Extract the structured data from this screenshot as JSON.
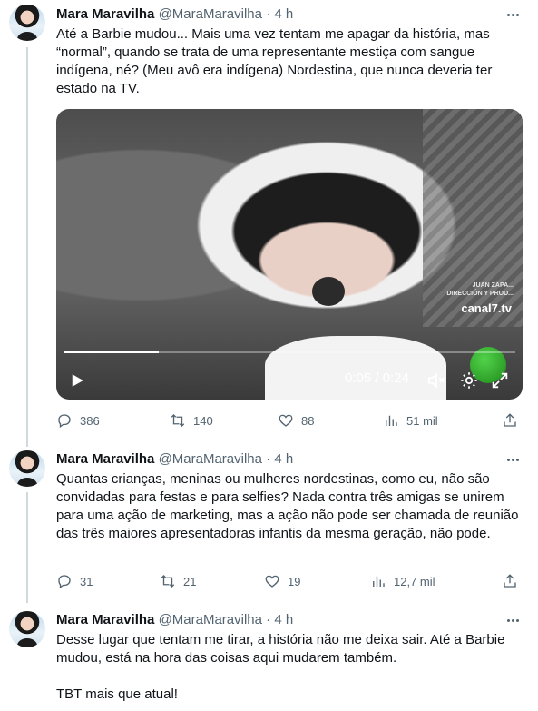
{
  "tweets": [
    {
      "author": "Mara Maravilha",
      "handle": "@MaraMaravilha",
      "separator": "·",
      "time": "4 h",
      "text": "Até a Barbie mudou... Mais uma vez tentam me apagar da história, mas “normal”, quando se trata de uma representante mestiça com sangue indígena, né? (Meu avô era indígena) Nordestina, que nunca deveria ter estado na TV.",
      "video": {
        "current_time": "0:05",
        "time_sep": "/",
        "duration": "0:24",
        "progress": 0.21,
        "watermark": "canal7.tv",
        "banner_line1": "JUAN ZAPA...",
        "banner_line2": "DIRECCIÓN Y PROD..."
      },
      "stats": {
        "replies": "386",
        "retweets": "140",
        "likes": "88",
        "views": "51 mil"
      }
    },
    {
      "author": "Mara Maravilha",
      "handle": "@MaraMaravilha",
      "separator": "·",
      "time": "4 h",
      "text": "Quantas crianças, meninas ou mulheres nordestinas, como eu, não são convidadas para festas e para selfies? Nada contra três amigas se unirem para uma ação de marketing, mas a ação não pode ser chamada de reunião das três maiores apresentadoras infantis da mesma geração, não pode.",
      "stats": {
        "replies": "31",
        "retweets": "21",
        "likes": "19",
        "views": "12,7 mil"
      }
    },
    {
      "author": "Mara Maravilha",
      "handle": "@MaraMaravilha",
      "separator": "·",
      "time": "4 h",
      "text": "Desse lugar que tentam me tirar, a história não me deixa sair. Até a Barbie mudou, está na hora das coisas aqui mudarem também.",
      "text2": "TBT mais que atual!"
    }
  ]
}
